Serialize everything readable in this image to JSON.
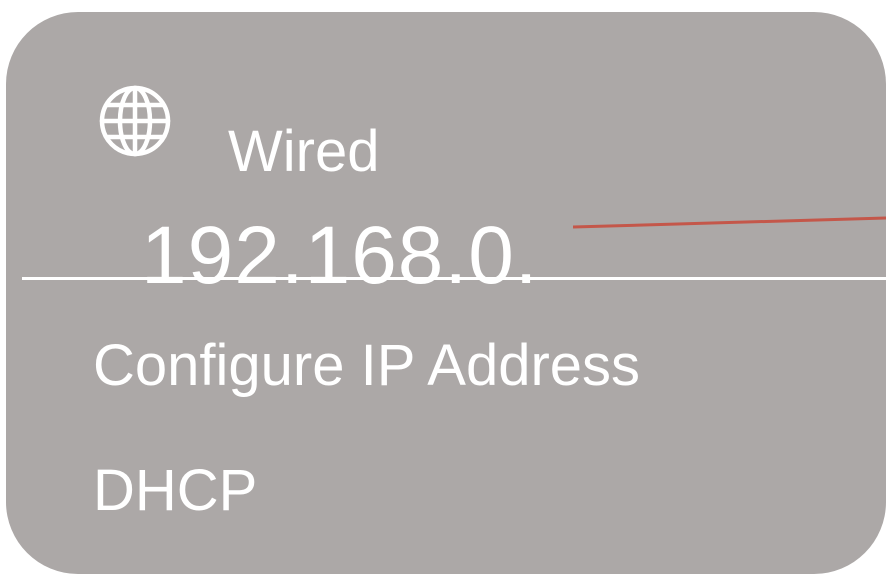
{
  "panel": {
    "background_color": "#aca8a7",
    "text_color": "#ffffff",
    "icon": "globe-icon",
    "connection_label": "Wired",
    "ip_address": "192.168.0."
  },
  "annotation": {
    "pointer_color": "#c4574a"
  },
  "menu": {
    "items": [
      {
        "label": "Configure IP Address"
      },
      {
        "label": "DHCP"
      }
    ]
  }
}
